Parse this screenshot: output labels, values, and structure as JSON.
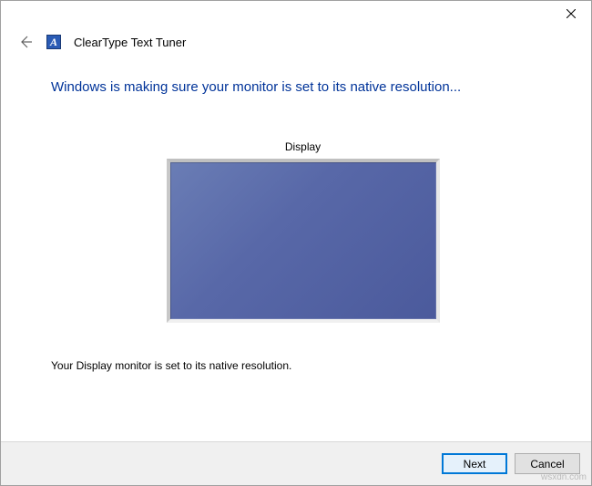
{
  "window": {
    "app_title": "ClearType Text Tuner",
    "app_icon_letter": "A"
  },
  "content": {
    "heading": "Windows is making sure your monitor is set to its native resolution...",
    "display_label": "Display",
    "status_text": "Your Display monitor is set to its native resolution."
  },
  "footer": {
    "next_label": "Next",
    "cancel_label": "Cancel"
  },
  "watermark": "wsxdn.com"
}
